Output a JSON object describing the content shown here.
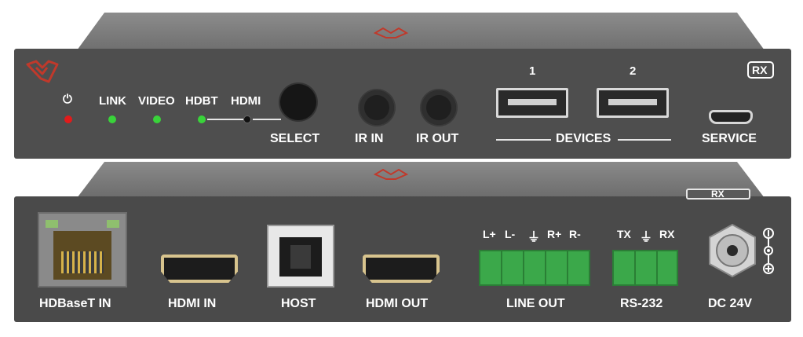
{
  "front": {
    "badge": "RX",
    "leds": {
      "power_icon": "power-icon",
      "link": "LINK",
      "video": "VIDEO",
      "hdbt": "HDBT",
      "hdmi": "HDMI"
    },
    "select": "SELECT",
    "ir_in": "IR IN",
    "ir_out": "IR OUT",
    "device_1": "1",
    "device_2": "2",
    "devices": "DEVICES",
    "service": "SERVICE",
    "colors": {
      "led_red": "#e21b1b",
      "led_green": "#39d33a",
      "brand": "#c0392b"
    }
  },
  "rear": {
    "badge": "RX",
    "hdbaset_in": "HDBaseT IN",
    "hdmi_in": "HDMI IN",
    "host": "HOST",
    "hdmi_out": "HDMI OUT",
    "line_out_pins": [
      "L+",
      "L-",
      "⏚",
      "R+",
      "R-"
    ],
    "line_out": "LINE OUT",
    "rs232_pins": [
      "TX",
      "⏚",
      "RX"
    ],
    "rs232": "RS-232",
    "dc": "DC 24V"
  }
}
